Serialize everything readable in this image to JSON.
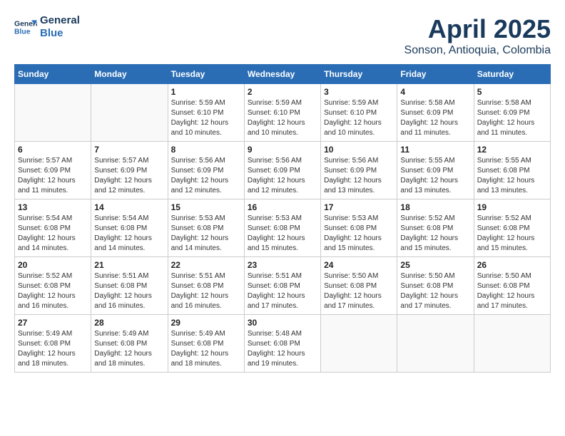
{
  "header": {
    "logo_line1": "General",
    "logo_line2": "Blue",
    "month_year": "April 2025",
    "location": "Sonson, Antioquia, Colombia"
  },
  "weekdays": [
    "Sunday",
    "Monday",
    "Tuesday",
    "Wednesday",
    "Thursday",
    "Friday",
    "Saturday"
  ],
  "weeks": [
    [
      {
        "day": "",
        "info": ""
      },
      {
        "day": "",
        "info": ""
      },
      {
        "day": "1",
        "info": "Sunrise: 5:59 AM\nSunset: 6:10 PM\nDaylight: 12 hours and 10 minutes."
      },
      {
        "day": "2",
        "info": "Sunrise: 5:59 AM\nSunset: 6:10 PM\nDaylight: 12 hours and 10 minutes."
      },
      {
        "day": "3",
        "info": "Sunrise: 5:59 AM\nSunset: 6:10 PM\nDaylight: 12 hours and 10 minutes."
      },
      {
        "day": "4",
        "info": "Sunrise: 5:58 AM\nSunset: 6:09 PM\nDaylight: 12 hours and 11 minutes."
      },
      {
        "day": "5",
        "info": "Sunrise: 5:58 AM\nSunset: 6:09 PM\nDaylight: 12 hours and 11 minutes."
      }
    ],
    [
      {
        "day": "6",
        "info": "Sunrise: 5:57 AM\nSunset: 6:09 PM\nDaylight: 12 hours and 11 minutes."
      },
      {
        "day": "7",
        "info": "Sunrise: 5:57 AM\nSunset: 6:09 PM\nDaylight: 12 hours and 12 minutes."
      },
      {
        "day": "8",
        "info": "Sunrise: 5:56 AM\nSunset: 6:09 PM\nDaylight: 12 hours and 12 minutes."
      },
      {
        "day": "9",
        "info": "Sunrise: 5:56 AM\nSunset: 6:09 PM\nDaylight: 12 hours and 12 minutes."
      },
      {
        "day": "10",
        "info": "Sunrise: 5:56 AM\nSunset: 6:09 PM\nDaylight: 12 hours and 13 minutes."
      },
      {
        "day": "11",
        "info": "Sunrise: 5:55 AM\nSunset: 6:09 PM\nDaylight: 12 hours and 13 minutes."
      },
      {
        "day": "12",
        "info": "Sunrise: 5:55 AM\nSunset: 6:08 PM\nDaylight: 12 hours and 13 minutes."
      }
    ],
    [
      {
        "day": "13",
        "info": "Sunrise: 5:54 AM\nSunset: 6:08 PM\nDaylight: 12 hours and 14 minutes."
      },
      {
        "day": "14",
        "info": "Sunrise: 5:54 AM\nSunset: 6:08 PM\nDaylight: 12 hours and 14 minutes."
      },
      {
        "day": "15",
        "info": "Sunrise: 5:53 AM\nSunset: 6:08 PM\nDaylight: 12 hours and 14 minutes."
      },
      {
        "day": "16",
        "info": "Sunrise: 5:53 AM\nSunset: 6:08 PM\nDaylight: 12 hours and 15 minutes."
      },
      {
        "day": "17",
        "info": "Sunrise: 5:53 AM\nSunset: 6:08 PM\nDaylight: 12 hours and 15 minutes."
      },
      {
        "day": "18",
        "info": "Sunrise: 5:52 AM\nSunset: 6:08 PM\nDaylight: 12 hours and 15 minutes."
      },
      {
        "day": "19",
        "info": "Sunrise: 5:52 AM\nSunset: 6:08 PM\nDaylight: 12 hours and 15 minutes."
      }
    ],
    [
      {
        "day": "20",
        "info": "Sunrise: 5:52 AM\nSunset: 6:08 PM\nDaylight: 12 hours and 16 minutes."
      },
      {
        "day": "21",
        "info": "Sunrise: 5:51 AM\nSunset: 6:08 PM\nDaylight: 12 hours and 16 minutes."
      },
      {
        "day": "22",
        "info": "Sunrise: 5:51 AM\nSunset: 6:08 PM\nDaylight: 12 hours and 16 minutes."
      },
      {
        "day": "23",
        "info": "Sunrise: 5:51 AM\nSunset: 6:08 PM\nDaylight: 12 hours and 17 minutes."
      },
      {
        "day": "24",
        "info": "Sunrise: 5:50 AM\nSunset: 6:08 PM\nDaylight: 12 hours and 17 minutes."
      },
      {
        "day": "25",
        "info": "Sunrise: 5:50 AM\nSunset: 6:08 PM\nDaylight: 12 hours and 17 minutes."
      },
      {
        "day": "26",
        "info": "Sunrise: 5:50 AM\nSunset: 6:08 PM\nDaylight: 12 hours and 17 minutes."
      }
    ],
    [
      {
        "day": "27",
        "info": "Sunrise: 5:49 AM\nSunset: 6:08 PM\nDaylight: 12 hours and 18 minutes."
      },
      {
        "day": "28",
        "info": "Sunrise: 5:49 AM\nSunset: 6:08 PM\nDaylight: 12 hours and 18 minutes."
      },
      {
        "day": "29",
        "info": "Sunrise: 5:49 AM\nSunset: 6:08 PM\nDaylight: 12 hours and 18 minutes."
      },
      {
        "day": "30",
        "info": "Sunrise: 5:48 AM\nSunset: 6:08 PM\nDaylight: 12 hours and 19 minutes."
      },
      {
        "day": "",
        "info": ""
      },
      {
        "day": "",
        "info": ""
      },
      {
        "day": "",
        "info": ""
      }
    ]
  ]
}
